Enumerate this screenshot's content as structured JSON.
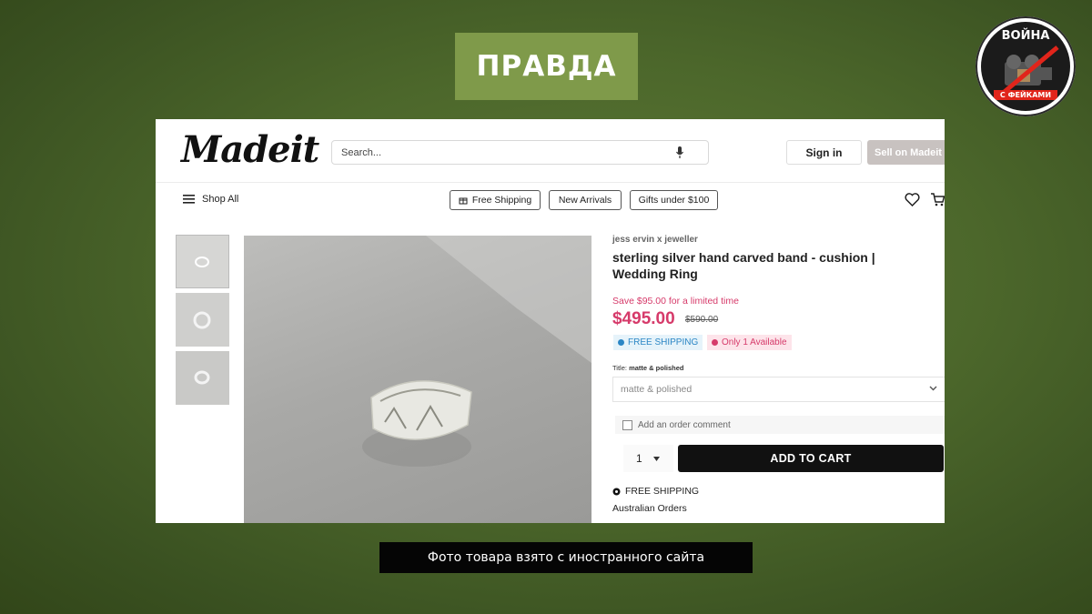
{
  "overlay": {
    "verdict": "ПРАВДА",
    "badge_title": "ВОЙНА",
    "badge_subtitle": "С ФЕЙКАМИ",
    "caption": "Фото товара взято с иностранного сайта"
  },
  "site": {
    "logo": "Madeit",
    "search_placeholder": "Search...",
    "sign_in": "Sign in",
    "sell": "Sell on Madeit",
    "shop_all": "Shop All",
    "nav_pills": [
      "Free Shipping",
      "New Arrivals",
      "Gifts under $100"
    ]
  },
  "product": {
    "seller": "jess ervin x jeweller",
    "title": "sterling silver hand carved band - cushion | Wedding Ring",
    "save_text": "Save $95.00 for a limited time",
    "price": "$495.00",
    "old_price": "$590.00",
    "tag_shipping": "FREE SHIPPING",
    "tag_stock": "Only 1 Available",
    "option_label": "Title:",
    "option_value_label": "matte & polished",
    "option_selected": "matte & polished",
    "comment_label": "Add an order comment",
    "quantity": "1",
    "add_to_cart": "ADD TO CART",
    "shipping_note": "FREE SHIPPING",
    "shipping_region": "Australian Orders"
  },
  "colors": {
    "accent_pink": "#d63a6a",
    "verdict_green": "#7f9a4a",
    "button_black": "#111111"
  }
}
